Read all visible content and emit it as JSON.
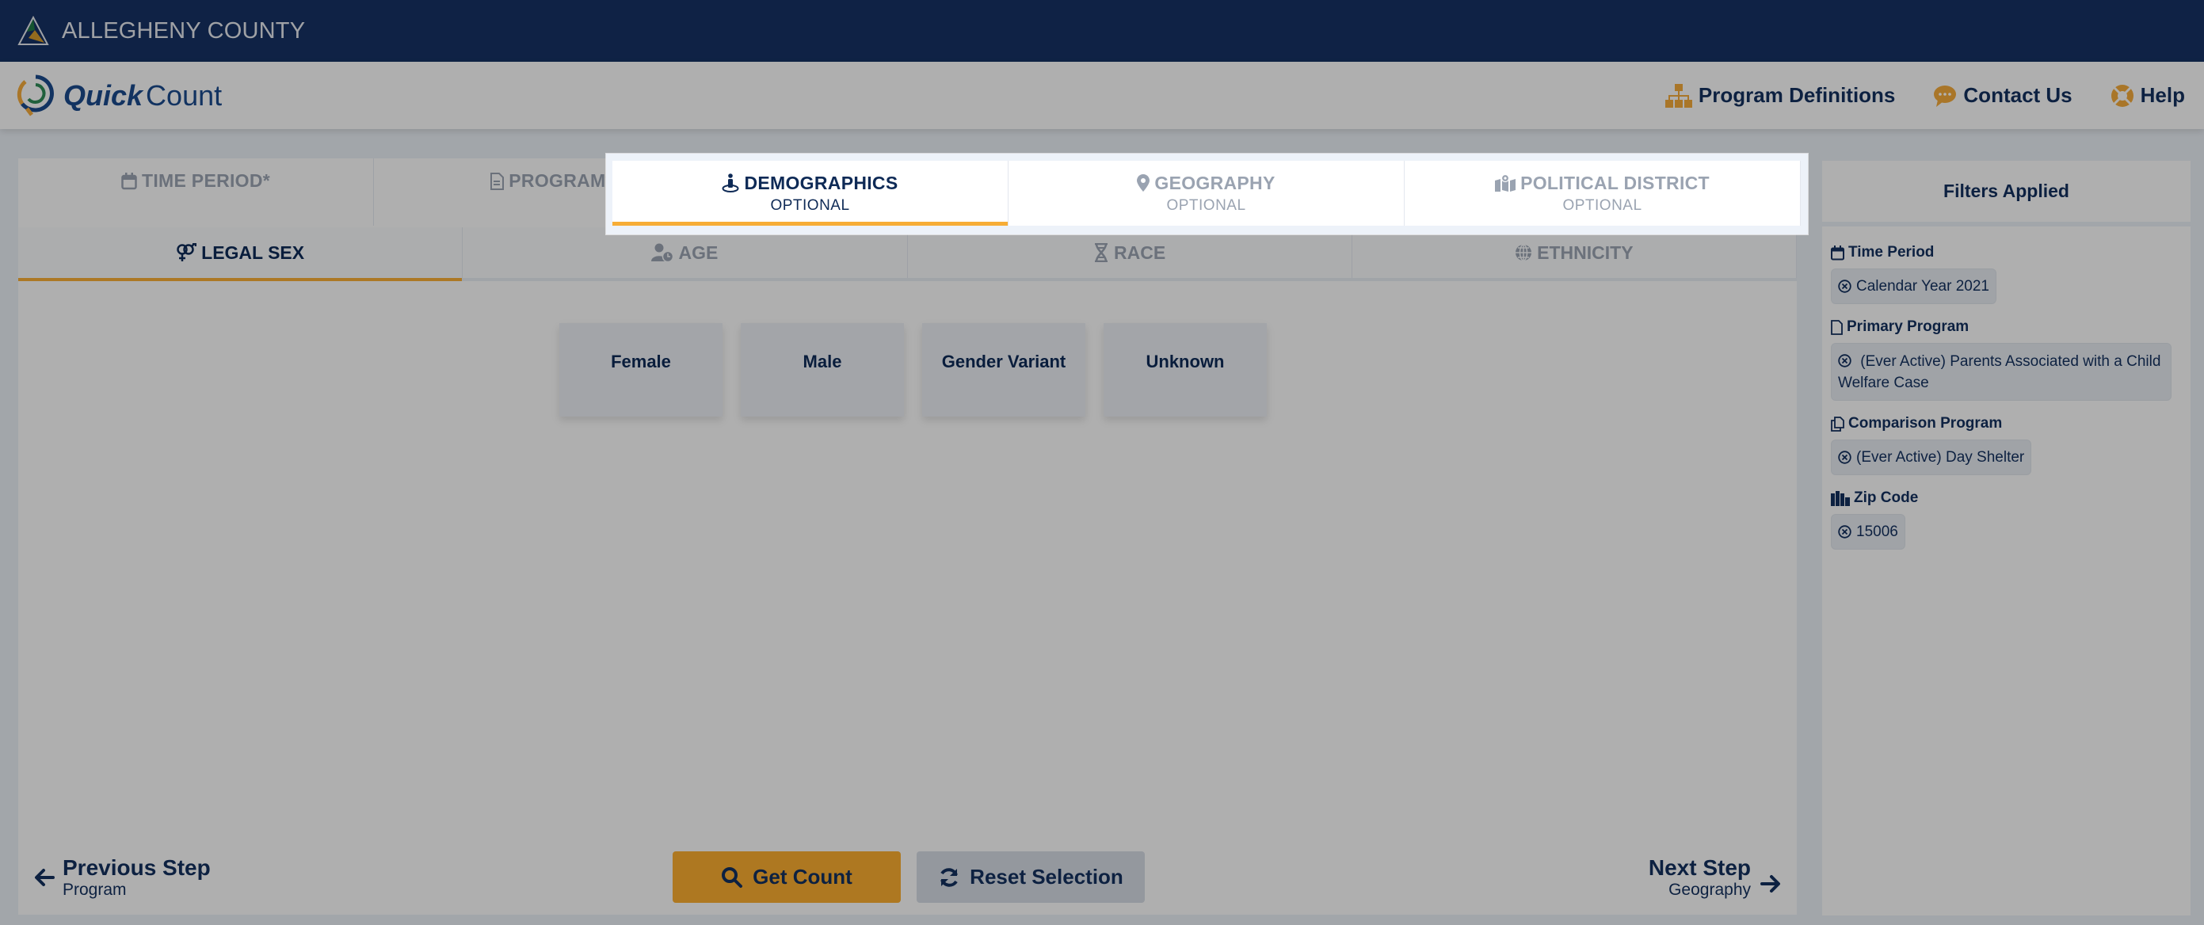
{
  "topbar": {
    "county_name": "ALLEGHENY COUNTY"
  },
  "brand": {
    "quick": "Quick",
    "count": "Count"
  },
  "nav": {
    "items": [
      {
        "label": "Program Definitions",
        "icon": "sitemap-icon"
      },
      {
        "label": "Contact Us",
        "icon": "comment-icon"
      },
      {
        "label": "Help",
        "icon": "life-ring-icon"
      }
    ]
  },
  "step_tabs": [
    {
      "label": "TIME PERIOD*",
      "sub": "",
      "icon": "calendar-icon",
      "active": false
    },
    {
      "label": "PROGRAM*",
      "sub": "",
      "icon": "file-icon",
      "active": false
    },
    {
      "label": "DEMOGRAPHICS",
      "sub": "OPTIONAL",
      "icon": "person-pin-icon",
      "active": true
    },
    {
      "label": "GEOGRAPHY",
      "sub": "OPTIONAL",
      "icon": "map-marker-icon",
      "active": false
    },
    {
      "label": "POLITICAL DISTRICT",
      "sub": "OPTIONAL",
      "icon": "map-location-icon",
      "active": false
    }
  ],
  "sub_tabs": [
    {
      "label": "LEGAL SEX",
      "icon": "venus-mars-icon",
      "active": true
    },
    {
      "label": "AGE",
      "icon": "user-clock-icon",
      "active": false
    },
    {
      "label": "RACE",
      "icon": "dna-icon",
      "active": false
    },
    {
      "label": "ETHNICITY",
      "icon": "globe-icon",
      "active": false
    }
  ],
  "options": [
    "Female",
    "Male",
    "Gender Variant",
    "Unknown"
  ],
  "footer": {
    "prev_label": "Previous Step",
    "prev_sub": "Program",
    "next_label": "Next Step",
    "next_sub": "Geography",
    "get_count": "Get Count",
    "reset": "Reset Selection"
  },
  "sidebar": {
    "title": "Filters Applied",
    "groups": [
      {
        "label": "Time Period",
        "icon": "calendar-icon",
        "chips": [
          "Calendar Year 2021"
        ]
      },
      {
        "label": "Primary Program",
        "icon": "file-icon",
        "chips": [
          "(Ever Active) Parents Associated with a Child Welfare Case"
        ]
      },
      {
        "label": "Comparison Program",
        "icon": "copy-icon",
        "chips": [
          "(Ever Active) Day Shelter"
        ]
      },
      {
        "label": "Zip Code",
        "icon": "city-icon",
        "chips": [
          "15006"
        ]
      }
    ]
  },
  "colors": {
    "navy": "#163263",
    "text": "#0e2a56",
    "accent": "#f7ad35",
    "muted": "#9aa3b1"
  }
}
